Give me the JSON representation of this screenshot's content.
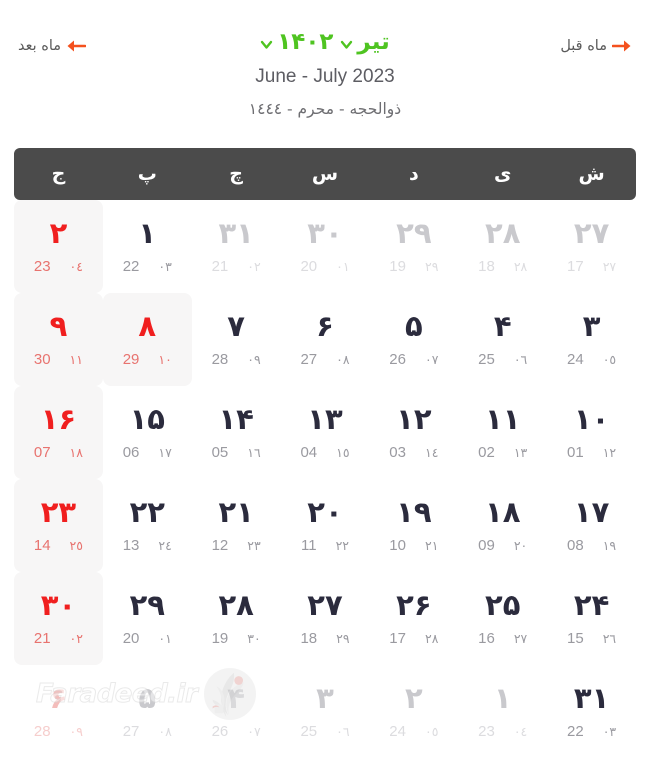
{
  "header": {
    "prev_month_label": "ماه قبل",
    "next_month_label": "ماه بعد",
    "month_label": "تیر",
    "year_label": "۱۴۰۲",
    "gregorian_range": "June - July 2023",
    "hijri_range": "ذوالحجه - محرم - ۱٤٤٤",
    "accent_green": "#4fc421",
    "accent_orange": "#f4511e",
    "holiday_red": "#f01f1f"
  },
  "weekdays": [
    {
      "label": "ش",
      "name": "shanbeh"
    },
    {
      "label": "ی",
      "name": "yekshanbeh"
    },
    {
      "label": "د",
      "name": "doshanbeh"
    },
    {
      "label": "س",
      "name": "seshanbeh"
    },
    {
      "label": "چ",
      "name": "chaharshanbeh"
    },
    {
      "label": "پ",
      "name": "panjshanbeh"
    },
    {
      "label": "ج",
      "name": "jomeh"
    }
  ],
  "weeks": [
    [
      {
        "day": "۲۷",
        "hijri": "۲۷",
        "greg": "17",
        "muted": true,
        "holiday": false,
        "highlight": false
      },
      {
        "day": "۲۸",
        "hijri": "۲۸",
        "greg": "18",
        "muted": true,
        "holiday": false,
        "highlight": false
      },
      {
        "day": "۲۹",
        "hijri": "۲۹",
        "greg": "19",
        "muted": true,
        "holiday": false,
        "highlight": false
      },
      {
        "day": "۳۰",
        "hijri": "۰۱",
        "greg": "20",
        "muted": true,
        "holiday": false,
        "highlight": false
      },
      {
        "day": "۳۱",
        "hijri": "۰۲",
        "greg": "21",
        "muted": true,
        "holiday": false,
        "highlight": false
      },
      {
        "day": "۱",
        "hijri": "۰۳",
        "greg": "22",
        "muted": false,
        "holiday": false,
        "highlight": false
      },
      {
        "day": "۲",
        "hijri": "۰٤",
        "greg": "23",
        "muted": false,
        "holiday": true,
        "highlight": true
      }
    ],
    [
      {
        "day": "۳",
        "hijri": "۰٥",
        "greg": "24",
        "muted": false,
        "holiday": false,
        "highlight": false
      },
      {
        "day": "۴",
        "hijri": "۰٦",
        "greg": "25",
        "muted": false,
        "holiday": false,
        "highlight": false
      },
      {
        "day": "۵",
        "hijri": "۰۷",
        "greg": "26",
        "muted": false,
        "holiday": false,
        "highlight": false
      },
      {
        "day": "۶",
        "hijri": "۰۸",
        "greg": "27",
        "muted": false,
        "holiday": false,
        "highlight": false
      },
      {
        "day": "۷",
        "hijri": "۰۹",
        "greg": "28",
        "muted": false,
        "holiday": false,
        "highlight": false
      },
      {
        "day": "۸",
        "hijri": "۱۰",
        "greg": "29",
        "muted": false,
        "holiday": true,
        "highlight": true
      },
      {
        "day": "۹",
        "hijri": "۱۱",
        "greg": "30",
        "muted": false,
        "holiday": true,
        "highlight": true
      }
    ],
    [
      {
        "day": "۱۰",
        "hijri": "۱۲",
        "greg": "01",
        "muted": false,
        "holiday": false,
        "highlight": false
      },
      {
        "day": "۱۱",
        "hijri": "۱۳",
        "greg": "02",
        "muted": false,
        "holiday": false,
        "highlight": false
      },
      {
        "day": "۱۲",
        "hijri": "۱٤",
        "greg": "03",
        "muted": false,
        "holiday": false,
        "highlight": false
      },
      {
        "day": "۱۳",
        "hijri": "۱٥",
        "greg": "04",
        "muted": false,
        "holiday": false,
        "highlight": false
      },
      {
        "day": "۱۴",
        "hijri": "۱٦",
        "greg": "05",
        "muted": false,
        "holiday": false,
        "highlight": false
      },
      {
        "day": "۱۵",
        "hijri": "۱۷",
        "greg": "06",
        "muted": false,
        "holiday": false,
        "highlight": false
      },
      {
        "day": "۱۶",
        "hijri": "۱۸",
        "greg": "07",
        "muted": false,
        "holiday": true,
        "highlight": true
      }
    ],
    [
      {
        "day": "۱۷",
        "hijri": "۱۹",
        "greg": "08",
        "muted": false,
        "holiday": false,
        "highlight": false
      },
      {
        "day": "۱۸",
        "hijri": "۲۰",
        "greg": "09",
        "muted": false,
        "holiday": false,
        "highlight": false
      },
      {
        "day": "۱۹",
        "hijri": "۲۱",
        "greg": "10",
        "muted": false,
        "holiday": false,
        "highlight": false
      },
      {
        "day": "۲۰",
        "hijri": "۲۲",
        "greg": "11",
        "muted": false,
        "holiday": false,
        "highlight": false
      },
      {
        "day": "۲۱",
        "hijri": "۲۳",
        "greg": "12",
        "muted": false,
        "holiday": false,
        "highlight": false
      },
      {
        "day": "۲۲",
        "hijri": "۲٤",
        "greg": "13",
        "muted": false,
        "holiday": false,
        "highlight": false
      },
      {
        "day": "۲۳",
        "hijri": "۲٥",
        "greg": "14",
        "muted": false,
        "holiday": true,
        "highlight": true
      }
    ],
    [
      {
        "day": "۲۴",
        "hijri": "۲٦",
        "greg": "15",
        "muted": false,
        "holiday": false,
        "highlight": false
      },
      {
        "day": "۲۵",
        "hijri": "۲۷",
        "greg": "16",
        "muted": false,
        "holiday": false,
        "highlight": false
      },
      {
        "day": "۲۶",
        "hijri": "۲۸",
        "greg": "17",
        "muted": false,
        "holiday": false,
        "highlight": false
      },
      {
        "day": "۲۷",
        "hijri": "۲۹",
        "greg": "18",
        "muted": false,
        "holiday": false,
        "highlight": false
      },
      {
        "day": "۲۸",
        "hijri": "۳۰",
        "greg": "19",
        "muted": false,
        "holiday": false,
        "highlight": false
      },
      {
        "day": "۲۹",
        "hijri": "۰۱",
        "greg": "20",
        "muted": false,
        "holiday": false,
        "highlight": false
      },
      {
        "day": "۳۰",
        "hijri": "۰۲",
        "greg": "21",
        "muted": false,
        "holiday": true,
        "highlight": true
      }
    ],
    [
      {
        "day": "۳۱",
        "hijri": "۰۳",
        "greg": "22",
        "muted": false,
        "holiday": false,
        "highlight": false
      },
      {
        "day": "۱",
        "hijri": "۰٤",
        "greg": "23",
        "muted": true,
        "holiday": false,
        "highlight": false
      },
      {
        "day": "۲",
        "hijri": "۰٥",
        "greg": "24",
        "muted": true,
        "holiday": false,
        "highlight": false
      },
      {
        "day": "۳",
        "hijri": "۰٦",
        "greg": "25",
        "muted": true,
        "holiday": false,
        "highlight": false
      },
      {
        "day": "۴",
        "hijri": "۰۷",
        "greg": "26",
        "muted": true,
        "holiday": false,
        "highlight": false
      },
      {
        "day": "۵",
        "hijri": "۰۸",
        "greg": "27",
        "muted": true,
        "holiday": false,
        "highlight": false
      },
      {
        "day": "۶",
        "hijri": "۰۹",
        "greg": "28",
        "muted": true,
        "holiday": true,
        "highlight": false
      }
    ]
  ],
  "watermark": {
    "text": "Faradeed.ir"
  }
}
